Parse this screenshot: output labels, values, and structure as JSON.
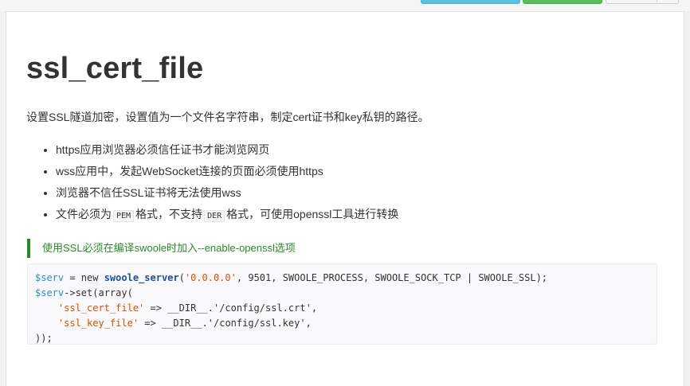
{
  "page": {
    "title": "ssl_cert_file",
    "intro": "设置SSL隧道加密，设置值为一个文件名字符串，制定cert证书和key私钥的路径。",
    "bullets": [
      {
        "text": "https应用浏览器必须信任证书才能浏览网页"
      },
      {
        "text": "wss应用中，发起WebSocket连接的页面必须使用https"
      },
      {
        "text": "浏览器不信任SSL证书将无法使用wss"
      },
      {
        "before": "文件必须为",
        "code1": "PEM",
        "middle": "格式，不支持",
        "code2": "DER",
        "after": "格式，可使用openssl工具进行转换"
      }
    ],
    "note": "使用SSL必须在编译swoole时加入--enable-openssl选项"
  },
  "code": {
    "l1": {
      "var": "$serv",
      "op": " = new ",
      "fn": "swoole_server",
      "p1": "(",
      "s1": "'0.0.0.0'",
      "rest": ", 9501, SWOOLE_PROCESS, SWOOLE_SOCK_TCP | SWOOLE_SSL);"
    },
    "l2": {
      "var": "$serv",
      "rest": "->set(array("
    },
    "l3": {
      "key": "'ssl_cert_file'",
      "arrow": " => __DIR__.",
      "val": "'/config/ssl.crt'",
      "end": ","
    },
    "l4": {
      "key": "'ssl_key_file'",
      "arrow": " => __DIR__.",
      "val": "'/config/ssl.key'",
      "end": ","
    },
    "l5": {
      "text": "));"
    }
  },
  "colors": {
    "note": "#2a8a2a",
    "btn_info": "#5bc0de",
    "btn_success": "#5cb85c"
  }
}
